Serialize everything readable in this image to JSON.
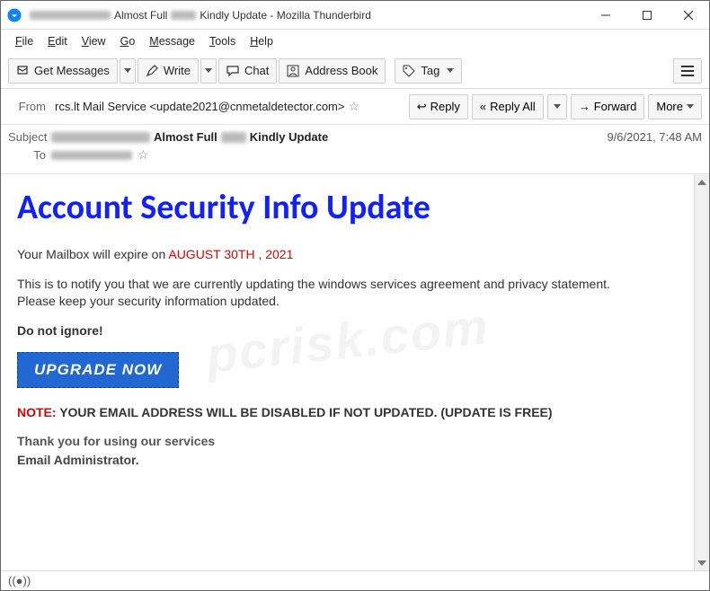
{
  "window": {
    "title_suffix": "Almost Full",
    "title_suffix2": "Kindly Update - Mozilla Thunderbird"
  },
  "menubar": {
    "file": "File",
    "edit": "Edit",
    "view": "View",
    "go": "Go",
    "message": "Message",
    "tools": "Tools",
    "help": "Help"
  },
  "toolbar": {
    "get_messages": "Get Messages",
    "write": "Write",
    "chat": "Chat",
    "address_book": "Address Book",
    "tag": "Tag"
  },
  "actions": {
    "from_label": "From",
    "from_value": "rcs.lt Mail Service <update2021@cnmetaldetector.com>",
    "reply": "Reply",
    "reply_all": "Reply All",
    "forward": "Forward",
    "more": "More"
  },
  "header": {
    "subject_label": "Subject",
    "subject_mid": "Almost Full",
    "subject_end": "Kindly Update",
    "to_label": "To",
    "date": "9/6/2021, 7:48 AM"
  },
  "body": {
    "h1": "Account Security Info Update",
    "expire_prefix": "Your Mailbox will expire on ",
    "expire_date": "AUGUST  30TH , 2021",
    "notice": "This is to notify you that we are currently updating the windows services agreement and privacy statement.\nPlease keep your security information updated.",
    "do_not_ignore": "Do not ignore!",
    "upgrade": "UPGRADE NOW",
    "note_label": "NOTE:",
    "note_text": " YOUR EMAIL ADDRESS WILL BE DISABLED IF NOT UPDATED. (UPDATE IS FREE)",
    "thanks": "Thank you for using our services",
    "signoff": "Email Administrator."
  },
  "status": {
    "sound_icon": "((●))"
  }
}
